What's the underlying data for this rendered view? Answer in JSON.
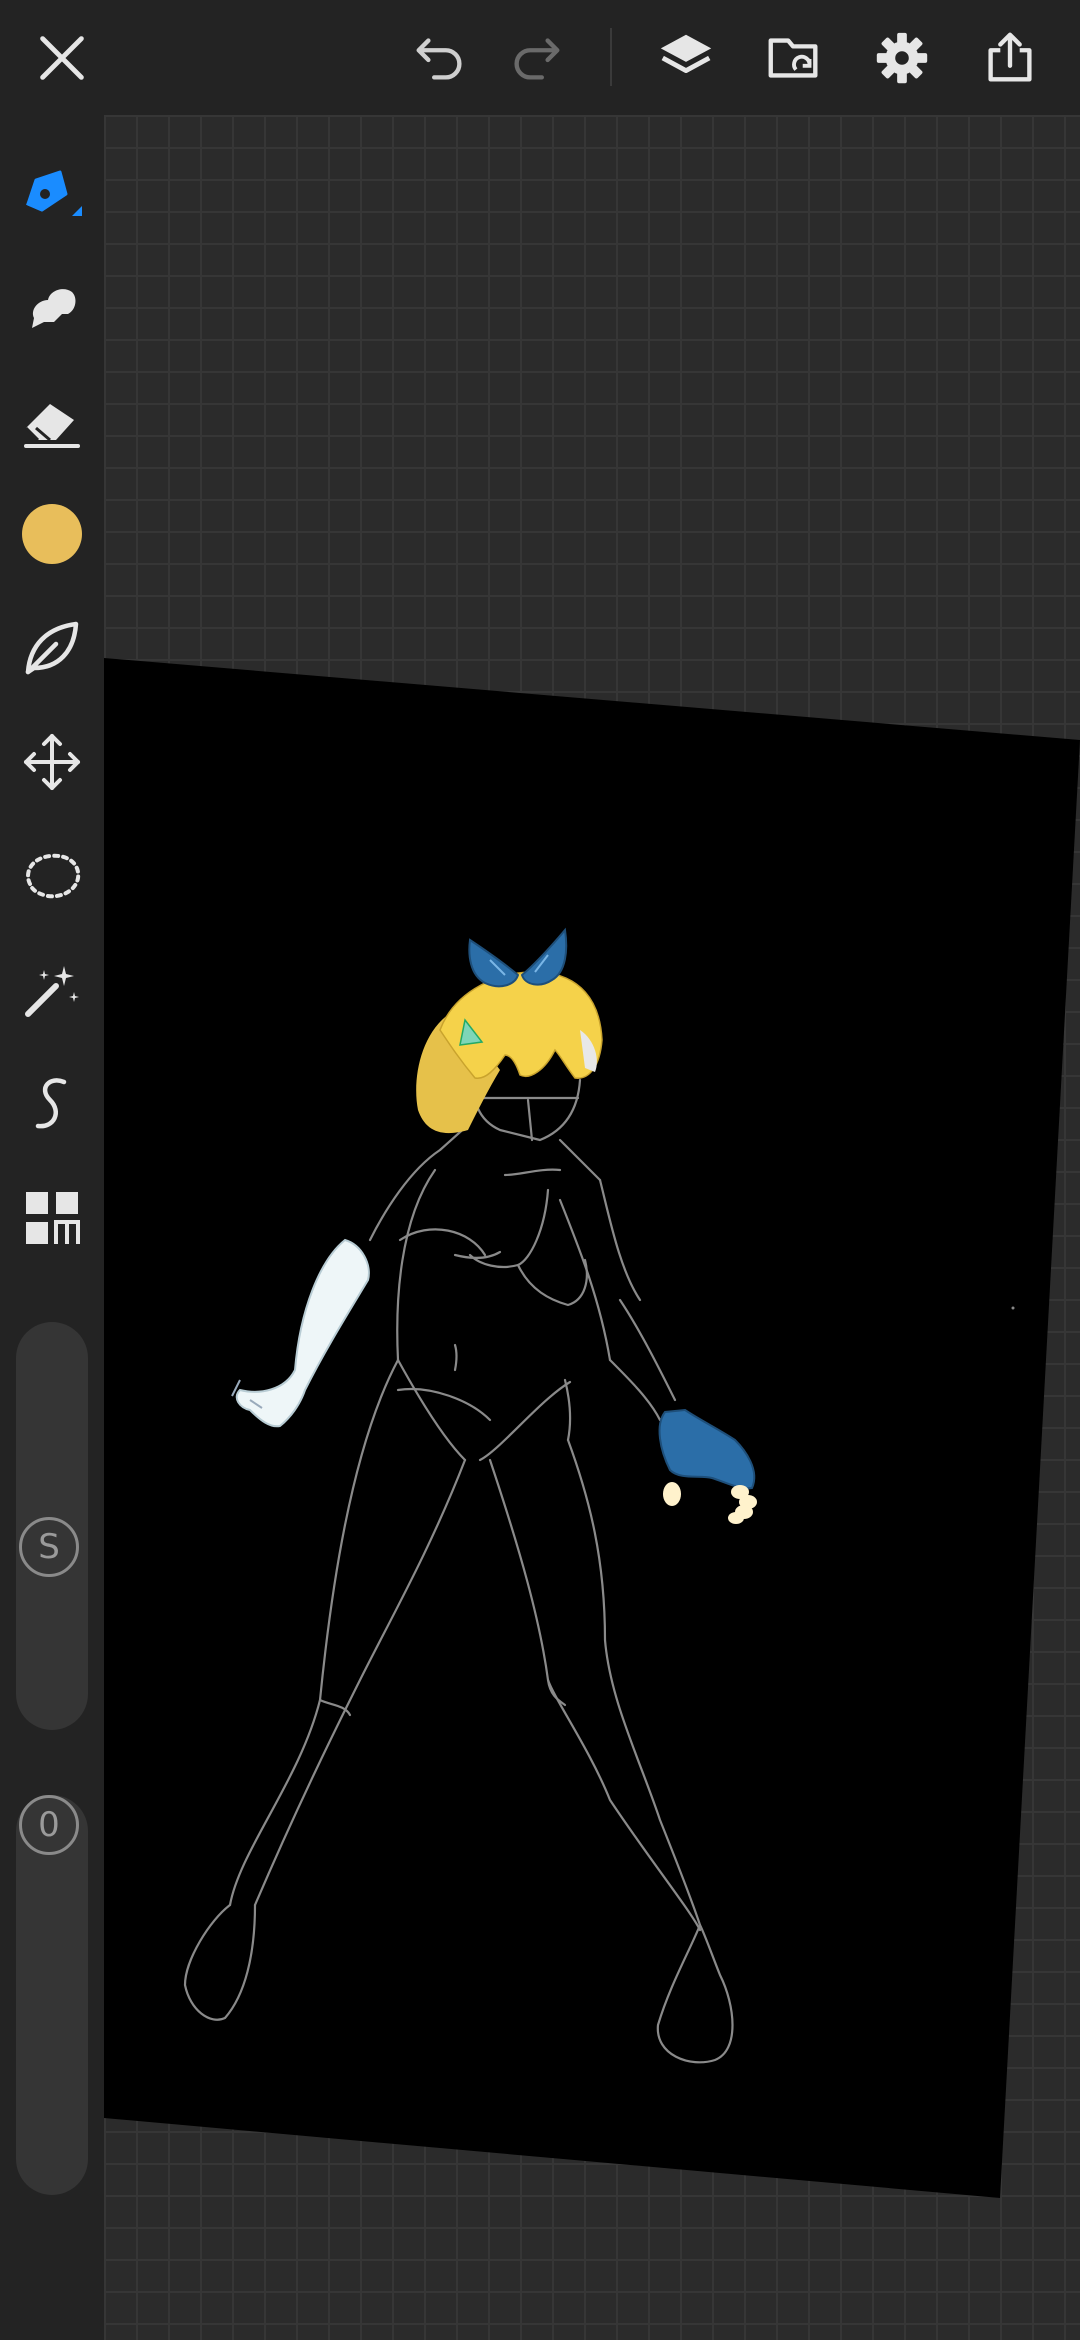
{
  "app": {
    "accent_color": "#1a8cff",
    "current_color": "#e8be5b",
    "icons_color": "#e6e6e6"
  },
  "top_toolbar": {
    "close": "close-icon",
    "undo": "undo-icon",
    "redo": "redo-icon",
    "layers": "layers-icon",
    "gallery": "folder-icon",
    "settings": "gear-icon",
    "export": "share-icon"
  },
  "tools": [
    {
      "name": "brush-tool",
      "icon": "pen-icon",
      "active": true
    },
    {
      "name": "smudge-tool",
      "icon": "smudge-icon"
    },
    {
      "name": "eraser-tool",
      "icon": "eraser-icon"
    },
    {
      "name": "color-picker",
      "icon": "color-swatch"
    },
    {
      "name": "brush-library",
      "icon": "leaf-icon"
    },
    {
      "name": "transform-tool",
      "icon": "move-icon"
    },
    {
      "name": "selection-tool",
      "icon": "lasso-icon"
    },
    {
      "name": "magic-wand-tool",
      "icon": "wand-icon"
    },
    {
      "name": "stroke-tool",
      "icon": "curve-icon"
    },
    {
      "name": "more-tools",
      "icon": "grid-icon"
    }
  ],
  "size_slider": {
    "label": "S"
  },
  "opacity_slider": {
    "label": "0"
  }
}
